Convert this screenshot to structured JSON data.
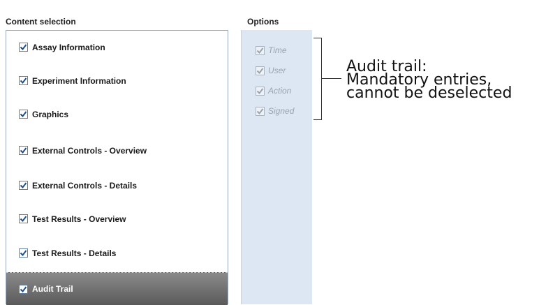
{
  "headers": {
    "content_selection": "Content selection",
    "options": "Options"
  },
  "content_items": [
    {
      "label": "Assay Information",
      "checked": true
    },
    {
      "label": "Experiment Information",
      "checked": true
    },
    {
      "label": "Graphics",
      "checked": true
    },
    {
      "label": "External Controls - Overview",
      "checked": true
    },
    {
      "label": "External Controls - Details",
      "checked": true
    },
    {
      "label": "Test Results - Overview",
      "checked": true
    },
    {
      "label": "Test Results - Details",
      "checked": true
    },
    {
      "label": "Audit Trail",
      "checked": true,
      "selected": true
    }
  ],
  "options": [
    {
      "label": "Time",
      "checked": true,
      "disabled": true
    },
    {
      "label": "User",
      "checked": true,
      "disabled": true
    },
    {
      "label": "Action",
      "checked": true,
      "disabled": true
    },
    {
      "label": "Signed",
      "checked": true,
      "disabled": true
    }
  ],
  "annotation": {
    "line1": "Audit trail:",
    "line2": "Mandatory entries,",
    "line3": "cannot be deselected"
  },
  "colors": {
    "checkmark": "#1f4e8c",
    "disabled_checkmark": "#9aa3ad",
    "selected_row": "#6e6e6e",
    "options_background": "#dde7f4"
  }
}
